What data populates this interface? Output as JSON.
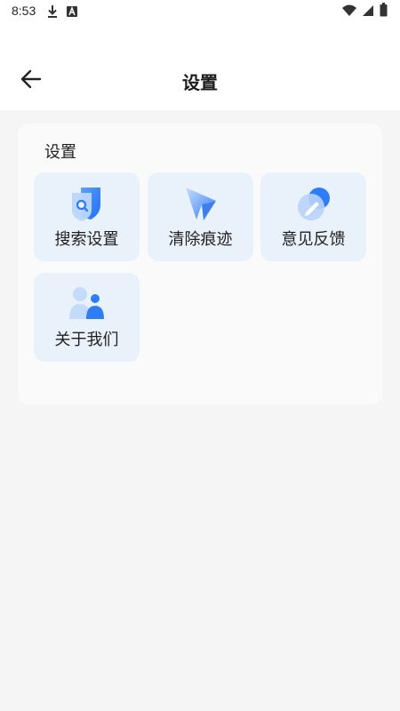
{
  "status_bar": {
    "time": "8:53",
    "icons_left": [
      "download-icon",
      "a-badge-icon"
    ],
    "icons_right": [
      "wifi-icon",
      "signal-icon",
      "battery-icon"
    ]
  },
  "app_bar": {
    "title": "设置",
    "back_icon": "arrow-left-icon"
  },
  "settings_card": {
    "title": "设置",
    "items": [
      {
        "label": "搜索设置",
        "icon": "shield-search-icon"
      },
      {
        "label": "清除痕迹",
        "icon": "cursor-arrow-icon"
      },
      {
        "label": "意见反馈",
        "icon": "edit-feedback-icon"
      },
      {
        "label": "关于我们",
        "icon": "people-icon"
      }
    ]
  },
  "colors": {
    "accent": "#2f7df6",
    "tile_background": "#e9f1fa",
    "page_background": "#f5f5f6"
  }
}
